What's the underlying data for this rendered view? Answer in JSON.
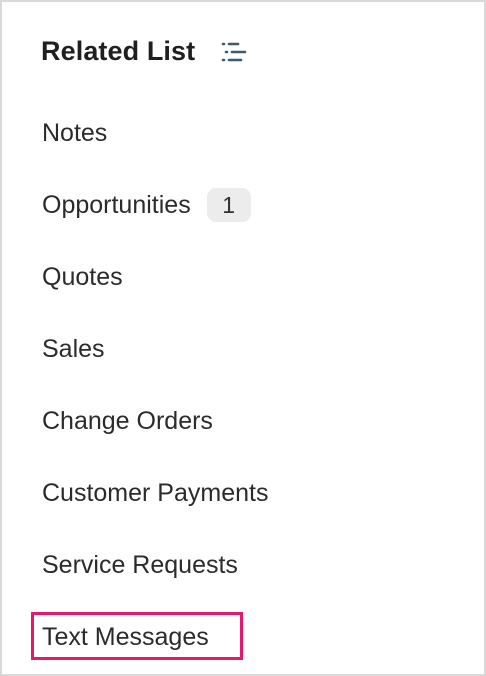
{
  "panel": {
    "title": "Related List",
    "filter_icon": "filter-list-icon",
    "items": [
      {
        "label": "Notes",
        "badge": ""
      },
      {
        "label": "Opportunities",
        "badge": "1"
      },
      {
        "label": "Quotes",
        "badge": ""
      },
      {
        "label": "Sales",
        "badge": ""
      },
      {
        "label": "Change Orders",
        "badge": ""
      },
      {
        "label": "Customer Payments",
        "badge": ""
      },
      {
        "label": "Service Requests",
        "badge": ""
      },
      {
        "label": "Text Messages",
        "badge": ""
      }
    ],
    "highlighted_item": "Text Messages",
    "highlight_color": "#e5186e"
  }
}
